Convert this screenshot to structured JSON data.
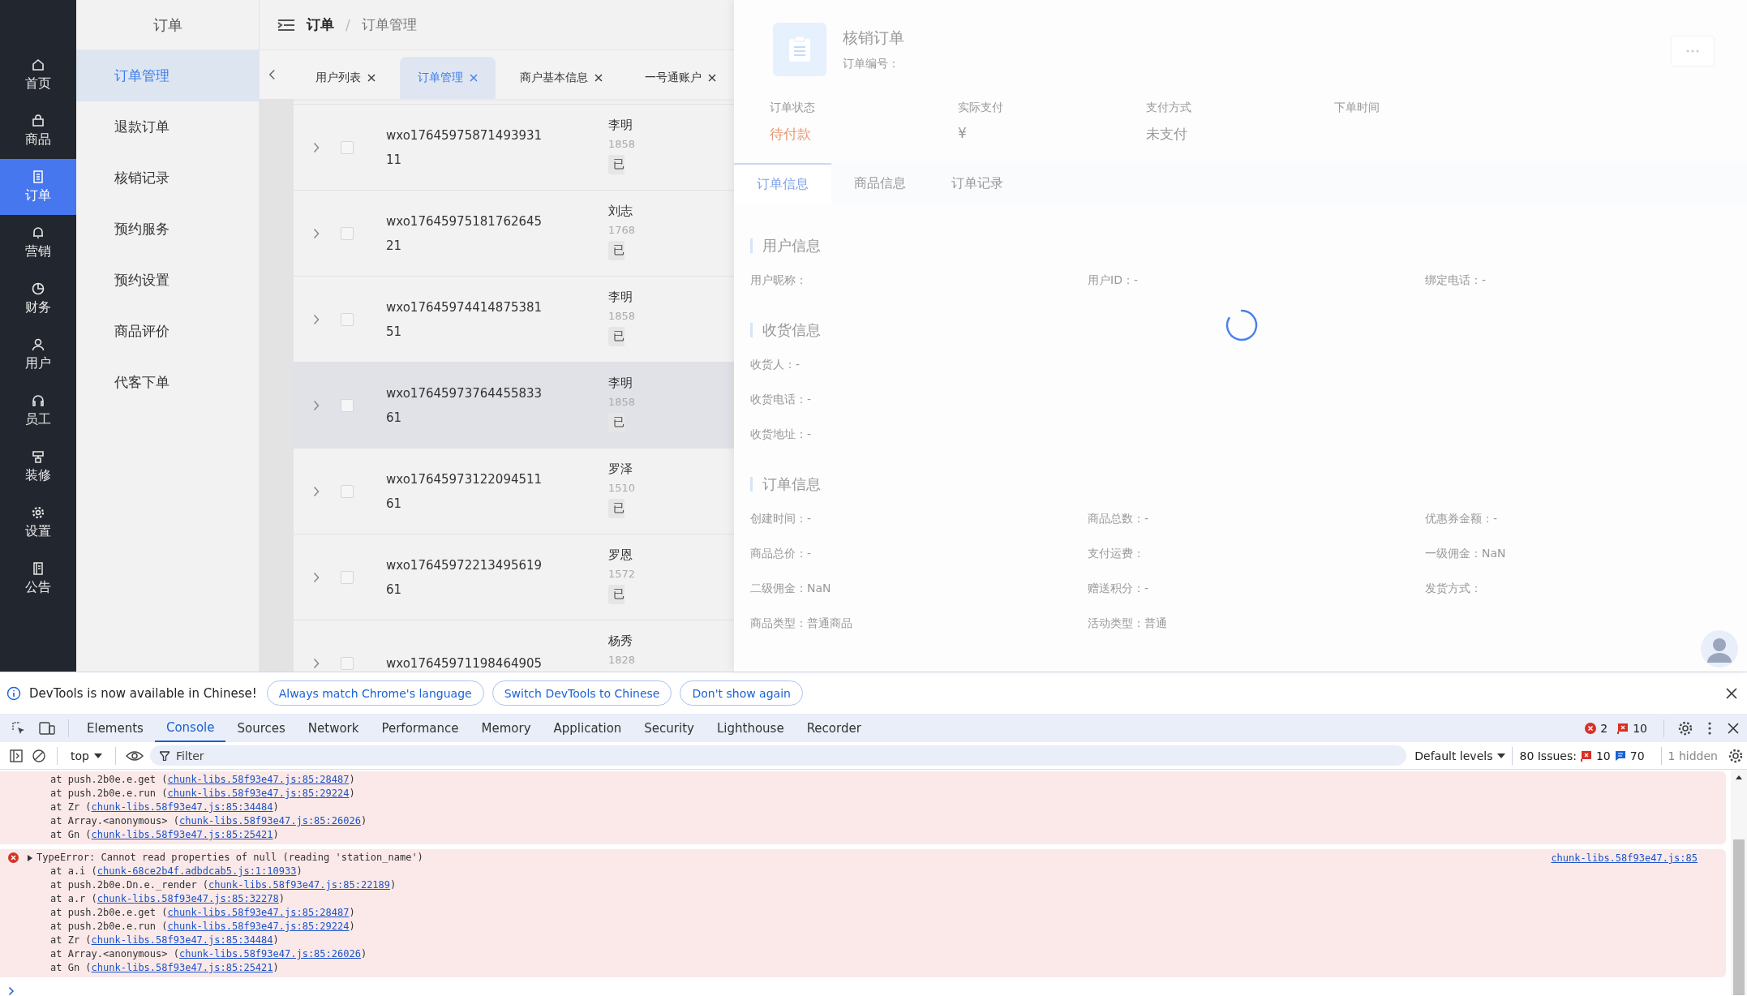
{
  "sidebar": {
    "items": [
      {
        "label": "首页",
        "selected": false
      },
      {
        "label": "商品",
        "selected": false
      },
      {
        "label": "订单",
        "selected": true
      },
      {
        "label": "营销",
        "selected": false
      },
      {
        "label": "财务",
        "selected": false
      },
      {
        "label": "用户",
        "selected": false
      },
      {
        "label": "员工",
        "selected": false
      },
      {
        "label": "装修",
        "selected": false
      },
      {
        "label": "设置",
        "selected": false
      },
      {
        "label": "公告",
        "selected": false
      }
    ]
  },
  "submenu": {
    "title": "订单",
    "items": [
      {
        "label": "订单管理",
        "selected": true
      },
      {
        "label": "退款订单",
        "selected": false
      },
      {
        "label": "核销记录",
        "selected": false
      },
      {
        "label": "预约服务",
        "selected": false
      },
      {
        "label": "预约设置",
        "selected": false
      },
      {
        "label": "商品评价",
        "selected": false
      },
      {
        "label": "代客下单",
        "selected": false
      }
    ]
  },
  "header": {
    "breadcrumb": [
      "订单",
      "订单管理"
    ],
    "separator": "/"
  },
  "tabs": [
    {
      "label": "用户列表",
      "selected": false
    },
    {
      "label": "订单管理",
      "selected": true
    },
    {
      "label": "商户基本信息",
      "selected": false
    },
    {
      "label": "一号通账户",
      "selected": false
    }
  ],
  "orders": [
    {
      "order_no": "wxo17645975871493931",
      "quantity": "11",
      "name": "李明",
      "phone": "1858",
      "tag": "已",
      "checked": false,
      "selected": false
    },
    {
      "order_no": "wxo17645975181762645",
      "quantity": "21",
      "name": "刘志",
      "phone": "1768",
      "tag": "已",
      "checked": false,
      "selected": false
    },
    {
      "order_no": "wxo17645974414875381",
      "quantity": "51",
      "name": "李明",
      "phone": "1858",
      "tag": "已",
      "checked": false,
      "selected": false
    },
    {
      "order_no": "wxo17645973764455833",
      "quantity": "61",
      "name": "李明",
      "phone": "1858",
      "tag": "已",
      "checked": false,
      "selected": true
    },
    {
      "order_no": "wxo17645973122094511",
      "quantity": "61",
      "name": "罗泽",
      "phone": "1510",
      "tag": "已",
      "checked": false,
      "selected": false
    },
    {
      "order_no": "wxo17645972213495619",
      "quantity": "61",
      "name": "罗恩",
      "phone": "1572",
      "tag": "已",
      "checked": false,
      "selected": false
    },
    {
      "order_no": "wxo17645971198464905",
      "name": "杨秀",
      "phone": "1828",
      "checked": false,
      "selected": false
    }
  ],
  "drawer": {
    "title": "核销订单",
    "subtitle": "订单编号：",
    "stats": [
      {
        "label": "订单状态",
        "value": "待付款",
        "kind": "status"
      },
      {
        "label": "实际支付",
        "value": "¥",
        "kind": "plain"
      },
      {
        "label": "支付方式",
        "value": "未支付",
        "kind": "plain"
      },
      {
        "label": "下单时间",
        "kind": "plain"
      }
    ],
    "tabs": [
      {
        "label": "订单信息",
        "selected": true
      },
      {
        "label": "商品信息",
        "selected": false
      },
      {
        "label": "订单记录",
        "selected": false
      }
    ],
    "sections": [
      {
        "title": "用户信息",
        "kind": "grid",
        "fields": [
          "用户昵称：",
          "用户ID：-",
          "绑定电话：-"
        ]
      },
      {
        "title": "收货信息",
        "kind": "list",
        "fields": [
          "收货人：-",
          "收货电话：-",
          "收货地址：-"
        ]
      },
      {
        "title": "订单信息",
        "kind": "grid",
        "fields": [
          "创建时间：-",
          "商品总数：-",
          "优惠券金额：-",
          "商品总价：-",
          "支付运费：",
          "一级佣金：NaN",
          "二级佣金：NaN",
          "赠送积分：-",
          "发货方式：",
          "商品类型：普通商品",
          "活动类型：普通"
        ]
      }
    ],
    "loading": true
  },
  "devtools": {
    "infobar": {
      "text": "DevTools is now available in Chinese!",
      "buttons": [
        "Always match Chrome's language",
        "Switch DevTools to Chinese",
        "Don't show again"
      ]
    },
    "tabs": [
      {
        "label": "Elements",
        "selected": false
      },
      {
        "label": "Console",
        "selected": true
      },
      {
        "label": "Sources",
        "selected": false
      },
      {
        "label": "Network",
        "selected": false
      },
      {
        "label": "Performance",
        "selected": false
      },
      {
        "label": "Memory",
        "selected": false
      },
      {
        "label": "Application",
        "selected": false
      },
      {
        "label": "Security",
        "selected": false
      },
      {
        "label": "Lighthouse",
        "selected": false
      },
      {
        "label": "Recorder",
        "selected": false
      }
    ],
    "error_count": "2",
    "issue_count": "10",
    "toolbar": {
      "context": "top",
      "filter_placeholder": "Filter",
      "levels": "Default levels",
      "issues_label": "80 Issues:",
      "issue_errors": "10",
      "issue_infos": "70",
      "hidden": "1 hidden"
    },
    "messages": [
      {
        "frames": [
          {
            "call": "at push.2b0e.e.get (",
            "link": "chunk-libs.58f93e47.js:85:28487",
            "end": ")"
          },
          {
            "call": "at push.2b0e.e.run (",
            "link": "chunk-libs.58f93e47.js:85:29224",
            "end": ")"
          },
          {
            "call": "at Zr (",
            "link": "chunk-libs.58f93e47.js:85:34484",
            "end": ")"
          },
          {
            "call": "at Array.<anonymous> (",
            "link": "chunk-libs.58f93e47.js:85:26026",
            "end": ")"
          },
          {
            "call": "at Gn (",
            "link": "chunk-libs.58f93e47.js:85:25421",
            "end": ")"
          }
        ]
      },
      {
        "text": "TypeError: Cannot read properties of null (reading 'station_name')",
        "source": "chunk-libs.58f93e47.js:85",
        "frames": [
          {
            "call": "at a.i (",
            "link": "chunk-68ce2b4f.adbdcab5.js:1:10933",
            "end": ")"
          },
          {
            "call": "at push.2b0e.Dn.e._render (",
            "link": "chunk-libs.58f93e47.js:85:22189",
            "end": ")"
          },
          {
            "call": "at a.r (",
            "link": "chunk-libs.58f93e47.js:85:32278",
            "end": ")"
          },
          {
            "call": "at push.2b0e.e.get (",
            "link": "chunk-libs.58f93e47.js:85:28487",
            "end": ")"
          },
          {
            "call": "at push.2b0e.e.run (",
            "link": "chunk-libs.58f93e47.js:85:29224",
            "end": ")"
          },
          {
            "call": "at Zr (",
            "link": "chunk-libs.58f93e47.js:85:34484",
            "end": ")"
          },
          {
            "call": "at Array.<anonymous> (",
            "link": "chunk-libs.58f93e47.js:85:26026",
            "end": ")"
          },
          {
            "call": "at Gn (",
            "link": "chunk-libs.58f93e47.js:85:25421",
            "end": ")"
          }
        ]
      }
    ]
  }
}
